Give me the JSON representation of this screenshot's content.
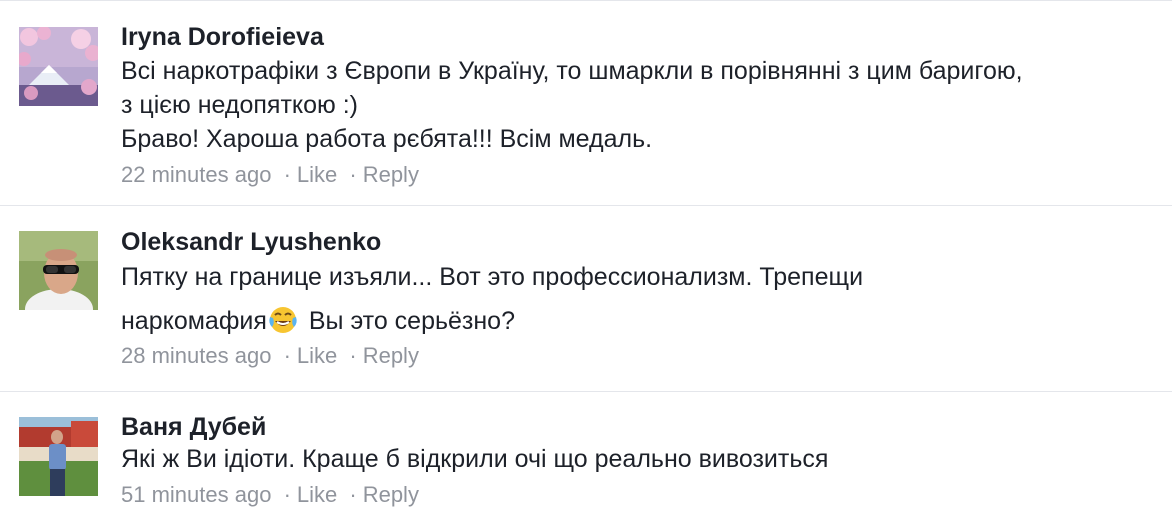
{
  "comments": [
    {
      "author": "Iryna Dorofieieva",
      "lines": [
        "Всі наркотрафіки з Європи в Україну, то шмаркли в порівнянні з цим баригою,",
        "з цією недопяткою :)",
        "Браво! Хароша работа рєбята!!! Всім медаль."
      ],
      "time": "22 minutes ago",
      "like": "Like",
      "reply": "Reply",
      "separator": "·"
    },
    {
      "author": "Oleksandr Lyushenko",
      "lines": [
        "Пятку на границе изъяли... Вот это профессионализм. Трепещи"
      ],
      "line2_before_emoji": "наркомафия",
      "line2_after_emoji": " Вы это серьёзно?",
      "emoji_icon": "face-with-tears-of-joy-icon",
      "time": "28 minutes ago",
      "like": "Like",
      "reply": "Reply",
      "separator": "·"
    },
    {
      "author": "Ваня Дубей",
      "lines": [
        "Які ж Ви ідіоти. Краще б відкрили очі що реально вивозиться"
      ],
      "time": "51 minutes ago",
      "like": "Like",
      "reply": "Reply",
      "separator": "·"
    }
  ],
  "colors": {
    "author": "#1d2129",
    "text": "#1d2129",
    "meta": "#90949c",
    "divider": "#e4e6eb"
  }
}
